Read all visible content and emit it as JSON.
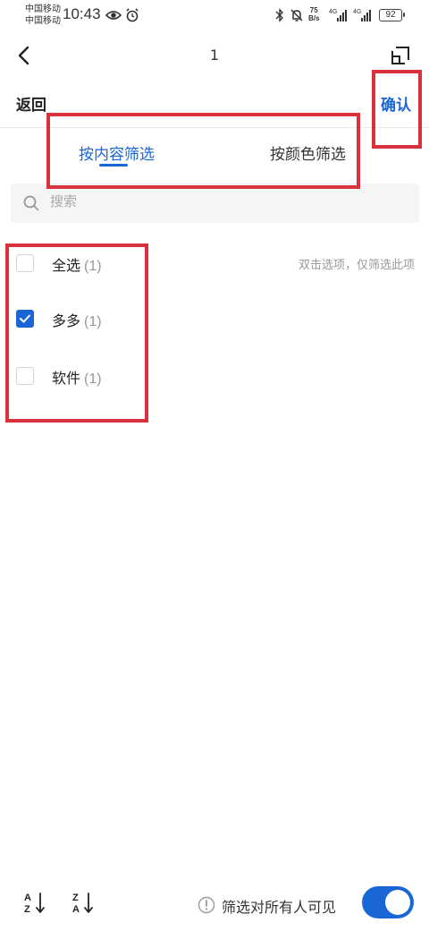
{
  "status_bar": {
    "carrier_1": "中国移动",
    "carrier_2": "中国移动",
    "time": "10:43",
    "net_speed_value": "75",
    "net_speed_unit": "B/s",
    "battery": "92"
  },
  "nav": {
    "title": "1"
  },
  "header": {
    "back_label": "返回",
    "confirm_label": "确认"
  },
  "tabs": [
    {
      "label": "按内容筛选",
      "active": true
    },
    {
      "label": "按颜色筛选",
      "active": false
    }
  ],
  "search": {
    "placeholder": "搜索",
    "value": ""
  },
  "hint": "双击选项，仅筛选此项",
  "options": [
    {
      "label": "全选",
      "count": "(1)",
      "checked": false
    },
    {
      "label": "多多",
      "count": "(1)",
      "checked": true
    },
    {
      "label": "软件",
      "count": "(1)",
      "checked": false
    }
  ],
  "footer": {
    "visibility_label": "筛选对所有人可见",
    "visibility_enabled": true
  },
  "colors": {
    "accent": "#1a66d6",
    "annotation": "#d8323e"
  },
  "icons": [
    "back-arrow-icon",
    "floating-window-icon",
    "search-icon",
    "sort-ascending-icon",
    "sort-descending-icon",
    "info-icon",
    "eye-icon",
    "alarm-icon",
    "bluetooth-icon",
    "mute-icon",
    "signal-icon",
    "battery-icon"
  ]
}
